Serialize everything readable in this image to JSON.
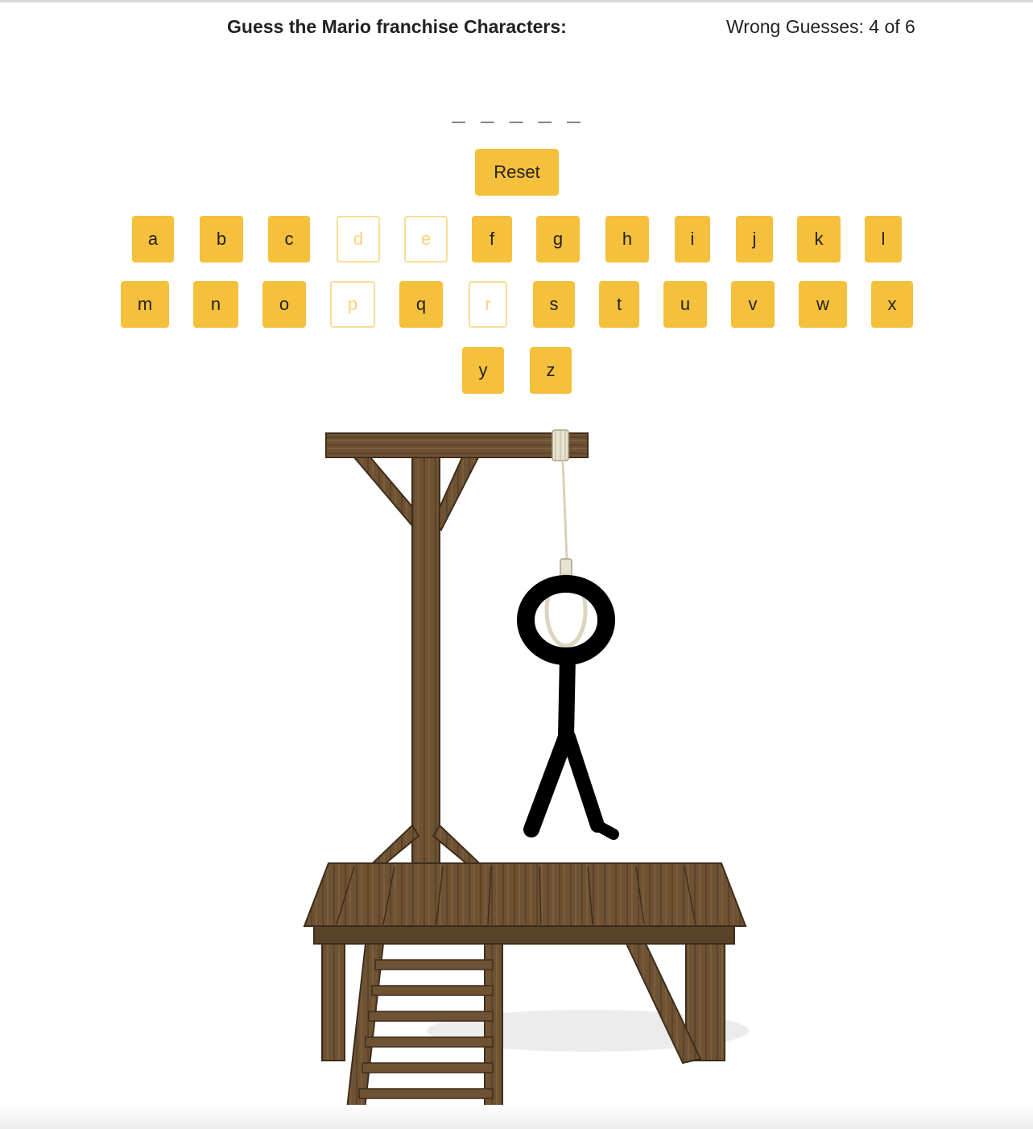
{
  "header": {
    "title": "Guess the Mario franchise Characters:",
    "wrong_guesses": "Wrong Guesses: 4 of 6"
  },
  "word": {
    "display": "_ _ _ _ _"
  },
  "controls": {
    "reset_label": "Reset"
  },
  "keyboard": {
    "rows": [
      [
        {
          "letter": "a",
          "used": false
        },
        {
          "letter": "b",
          "used": false
        },
        {
          "letter": "c",
          "used": false
        },
        {
          "letter": "d",
          "used": true
        },
        {
          "letter": "e",
          "used": true
        },
        {
          "letter": "f",
          "used": false
        },
        {
          "letter": "g",
          "used": false
        },
        {
          "letter": "h",
          "used": false
        },
        {
          "letter": "i",
          "used": false
        },
        {
          "letter": "j",
          "used": false
        },
        {
          "letter": "k",
          "used": false
        },
        {
          "letter": "l",
          "used": false
        }
      ],
      [
        {
          "letter": "m",
          "used": false
        },
        {
          "letter": "n",
          "used": false
        },
        {
          "letter": "o",
          "used": false
        },
        {
          "letter": "p",
          "used": true
        },
        {
          "letter": "q",
          "used": false
        },
        {
          "letter": "r",
          "used": true
        },
        {
          "letter": "s",
          "used": false
        },
        {
          "letter": "t",
          "used": false
        },
        {
          "letter": "u",
          "used": false
        },
        {
          "letter": "v",
          "used": false
        },
        {
          "letter": "w",
          "used": false
        },
        {
          "letter": "x",
          "used": false
        }
      ],
      [
        {
          "letter": "y",
          "used": false
        },
        {
          "letter": "z",
          "used": false
        }
      ]
    ]
  },
  "colors": {
    "accent": "#f5c03c",
    "used_border": "#f8dd96",
    "used_text": "#f6d37d"
  },
  "images": {
    "gallows": "gallows-icon",
    "stick_figure": "stick-figure-icon"
  }
}
